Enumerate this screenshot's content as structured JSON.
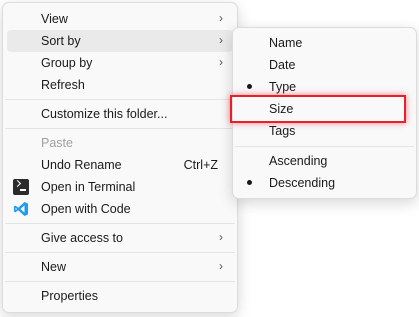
{
  "context_menu": {
    "view": "View",
    "sort_by": "Sort by",
    "group_by": "Group by",
    "refresh": "Refresh",
    "customize": "Customize this folder...",
    "paste": "Paste",
    "undo_rename": "Undo Rename",
    "undo_shortcut": "Ctrl+Z",
    "open_terminal": "Open in Terminal",
    "open_code": "Open with Code",
    "give_access": "Give access to",
    "new": "New",
    "properties": "Properties"
  },
  "sort_submenu": {
    "name": "Name",
    "date": "Date",
    "type": "Type",
    "size": "Size",
    "tags": "Tags",
    "ascending": "Ascending",
    "descending": "Descending"
  },
  "arrow_glyph": "›",
  "colors": {
    "highlight_border": "#e8202a",
    "vscode_blue": "#1f9cf0"
  }
}
